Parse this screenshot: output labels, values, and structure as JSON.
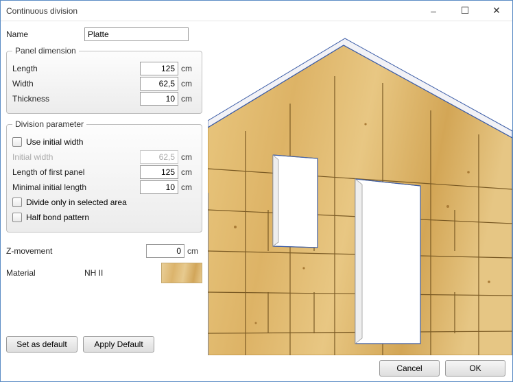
{
  "window": {
    "title": "Continuous division",
    "minimize": "–",
    "maximize": "□",
    "close": "✕"
  },
  "name": {
    "label": "Name",
    "value": "Platte"
  },
  "panel_dim": {
    "legend": "Panel dimension",
    "length_label": "Length",
    "length_value": "125",
    "width_label": "Width",
    "width_value": "62,5",
    "thickness_label": "Thickness",
    "thickness_value": "10",
    "unit": "cm"
  },
  "division": {
    "legend": "Division parameter",
    "use_initial_width_label": "Use initial width",
    "use_initial_width_checked": false,
    "initial_width_label": "Initial width",
    "initial_width_value": "62,5",
    "first_panel_label": "Length of first panel",
    "first_panel_value": "125",
    "min_initial_label": "Minimal initial length",
    "min_initial_value": "10",
    "divide_selected_label": "Divide only in selected area",
    "divide_selected_checked": false,
    "half_bond_label": "Half bond pattern",
    "half_bond_checked": false,
    "unit": "cm"
  },
  "zmove": {
    "label": "Z-movement",
    "value": "0",
    "unit": "cm"
  },
  "material": {
    "label": "Material",
    "value": "NH II"
  },
  "buttons": {
    "set_default": "Set as default",
    "apply_default": "Apply Default",
    "cancel": "Cancel",
    "ok": "OK"
  }
}
